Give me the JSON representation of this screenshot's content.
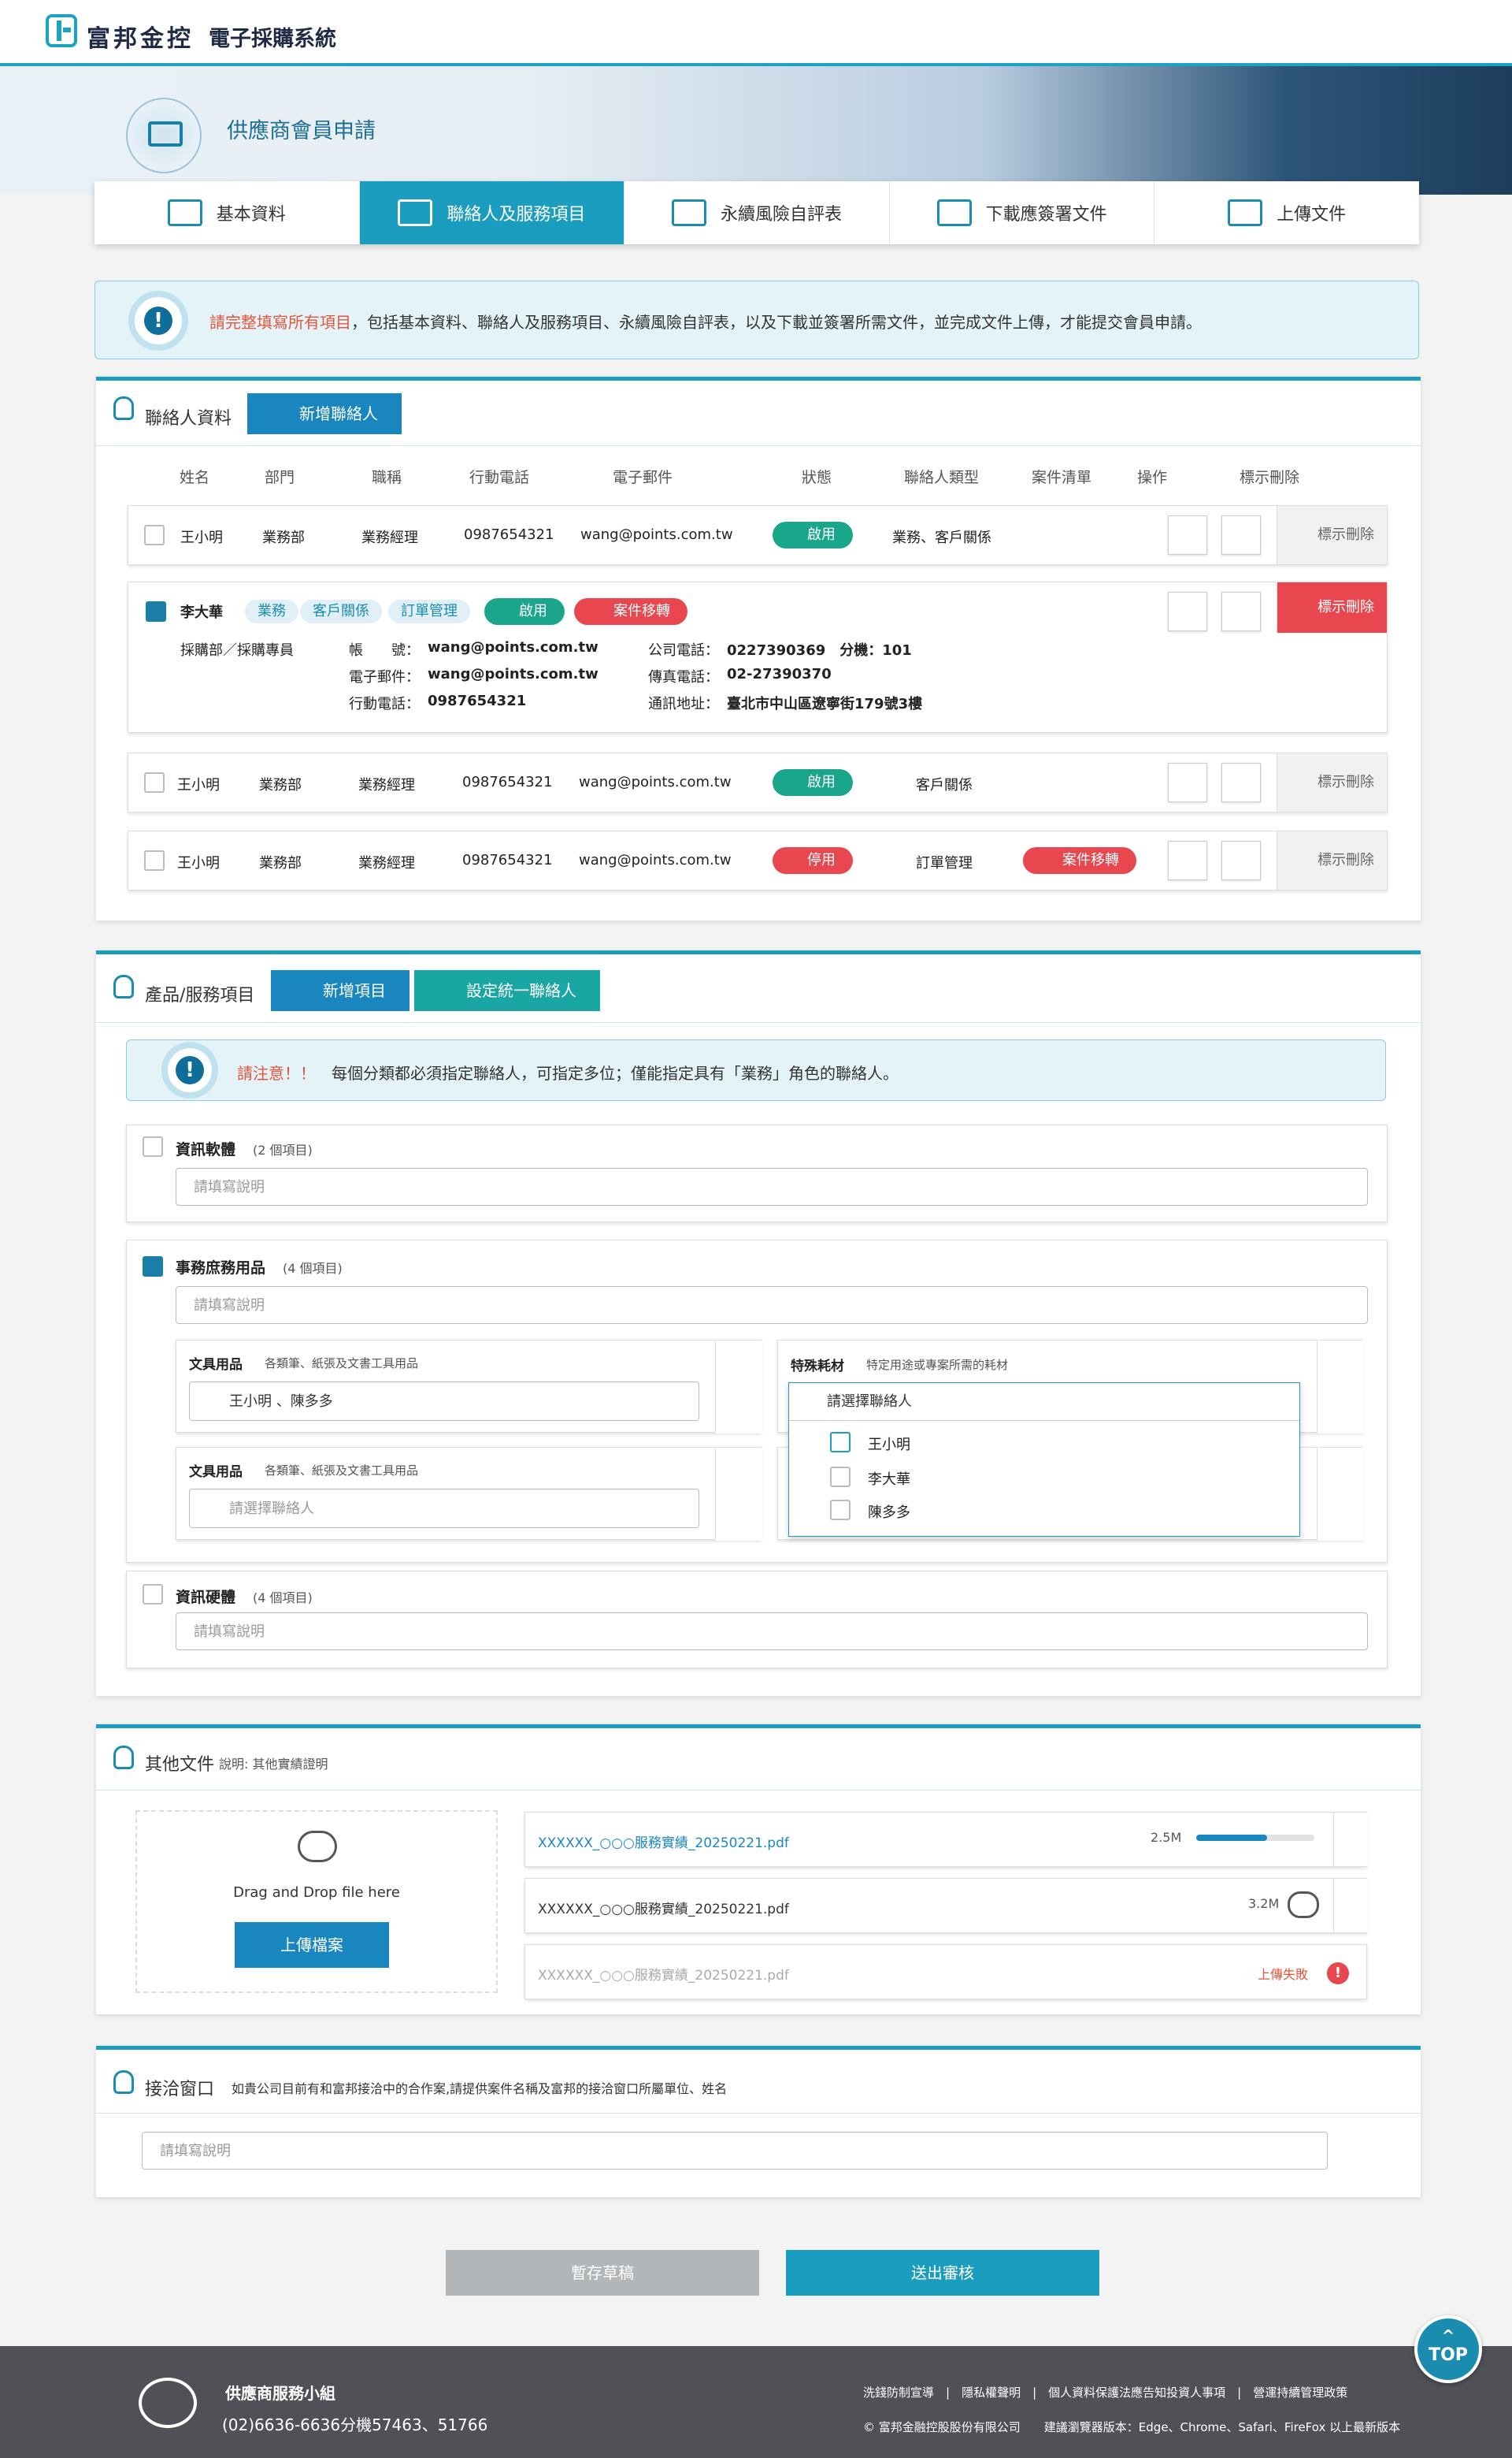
{
  "header": {
    "brand": "富邦金控",
    "system": "電子採購系統"
  },
  "banner": {
    "title": "供應商會員申請"
  },
  "tabs": [
    {
      "label": "基本資料",
      "active": false
    },
    {
      "label": "聯絡人及服務項目",
      "active": true
    },
    {
      "label": "永續風險自評表",
      "active": false
    },
    {
      "label": "下載應簽署文件",
      "active": false
    },
    {
      "label": "上傳文件",
      "active": false
    }
  ],
  "alert": {
    "highlight": "請完整填寫所有項目",
    "text": "，包括基本資料、聯絡人及服務項目、永續風險自評表，以及下載並簽署所需文件，並完成文件上傳，才能提交會員申請。"
  },
  "contacts": {
    "title": "聯絡人資料",
    "add_label": "新增聯絡人",
    "headers": [
      "姓名",
      "部門",
      "職稱",
      "行動電話",
      "電子郵件",
      "狀態",
      "聯絡人類型",
      "案件清單",
      "操作",
      "標示刪除"
    ],
    "rows": [
      {
        "name": "王小明",
        "dept": "業務部",
        "title": "業務經理",
        "mobile": "0987654321",
        "email": "wang@points.com.tw",
        "status": "啟用",
        "type": "業務、客戶關係",
        "mark": "標示刪除"
      },
      {
        "name": "王小明",
        "dept": "業務部",
        "title": "業務經理",
        "mobile": "0987654321",
        "email": "wang@points.com.tw",
        "status": "啟用",
        "type": "客戶關係",
        "mark": "標示刪除"
      },
      {
        "name": "王小明",
        "dept": "業務部",
        "title": "業務經理",
        "mobile": "0987654321",
        "email": "wang@points.com.tw",
        "status": "停用",
        "type": "訂單管理",
        "case": "案件移轉",
        "mark": "標示刪除"
      }
    ],
    "expanded": {
      "name": "李大華",
      "tags": [
        "業務",
        "客戶關係",
        "訂單管理"
      ],
      "status": "啟用",
      "case": "案件移轉",
      "mark": "標示刪除",
      "dept_title": "採購部／採購專員",
      "account_label": "帳　　號：",
      "account": "wang@points.com.tw",
      "email_label": "電子郵件：",
      "email": "wang@points.com.tw",
      "mobile_label": "行動電話：",
      "mobile": "0987654321",
      "phone_label": "公司電話：",
      "phone": "0227390369　分機：101",
      "fax_label": "傳真電話：",
      "fax": "02-27390370",
      "addr_label": "通訊地址：",
      "addr": "臺北市中山區遼寧街179號3樓"
    }
  },
  "products": {
    "title": "產品/服務項目",
    "add_label": "新增項目",
    "set_label": "設定統一聯絡人",
    "notice_highlight": "請注意！！",
    "notice_text": "每個分類都必須指定聯絡人，可指定多位；僅能指定具有「業務」角色的聯絡人。",
    "desc_placeholder": "請填寫說明",
    "groups": [
      {
        "name": "資訊軟體",
        "count": "(2 個項目)"
      },
      {
        "name": "事務庶務用品",
        "count": "(4 個項目)"
      },
      {
        "name": "資訊硬體",
        "count": "(4 個項目)"
      }
    ],
    "items": [
      {
        "name": "文具用品",
        "desc": "各類筆、紙張及文書工具用品",
        "value": "王小明 、陳多多"
      },
      {
        "name": "特殊耗材",
        "desc": "特定用途或專案所需的耗材",
        "value": "請選擇聯絡人"
      },
      {
        "name": "文具用品",
        "desc": "各類筆、紙張及文書工具用品",
        "value": "請選擇聯絡人"
      }
    ],
    "dropdown": [
      {
        "label": "王小明",
        "checked": true
      },
      {
        "label": "李大華",
        "checked": false
      },
      {
        "label": "陳多多",
        "checked": false
      }
    ]
  },
  "files": {
    "title": "其他文件",
    "subtitle": "說明: 其他實績證明",
    "drop_text": "Drag and Drop file here",
    "upload_label": "上傳檔案",
    "list": [
      {
        "name": "XXXXXX_○○○服務實績_20250221.pdf",
        "size": "2.5M",
        "progress": 0.6
      },
      {
        "name": "XXXXXX_○○○服務實績_20250221.pdf",
        "size": "3.2M"
      },
      {
        "name": "XXXXXX_○○○服務實績_20250221.pdf",
        "status": "上傳失敗"
      }
    ]
  },
  "window": {
    "title": "接洽窗口",
    "desc": "如貴公司目前有和富邦接洽中的合作案,請提供案件名稱及富邦的接洽窗口所屬單位、姓名",
    "placeholder": "請填寫說明"
  },
  "actions": {
    "draft": "暫存草稿",
    "submit": "送出審核"
  },
  "footer": {
    "group": "供應商服務小組",
    "phone": "(02)6636-6636分機57463、51766",
    "links": [
      "洗錢防制宣導",
      "隱私權聲明",
      "個人資料保護法應告知投資人事項",
      "營運持續管理政策"
    ],
    "copyright": "© 富邦金融控股股份有限公司",
    "browser": "建議瀏覽器版本：Edge、Chrome、Safari、FireFox 以上最新版本"
  },
  "top_label": "TOP",
  "colors": {
    "primary": "#1a9dbf",
    "danger": "#e8474f",
    "success": "#1aa68a"
  }
}
